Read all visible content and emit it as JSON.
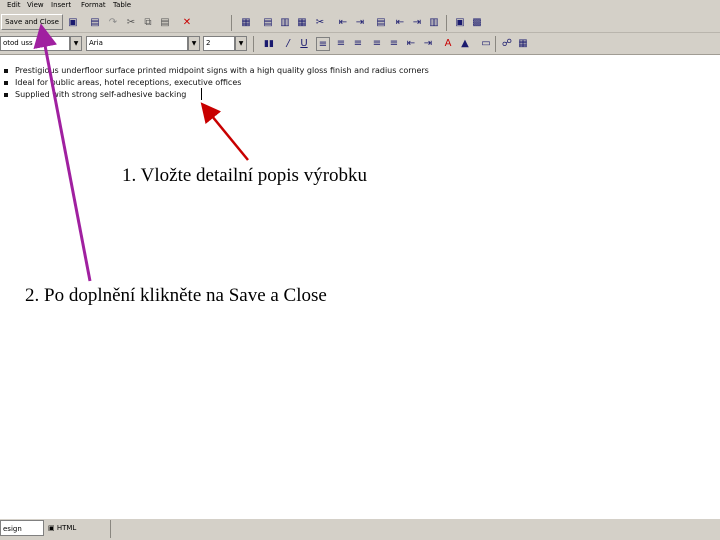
{
  "menu": {
    "items": [
      "Edit",
      "View",
      "Insert",
      "Format",
      "Table"
    ]
  },
  "toolbar": {
    "save_and_close_label": "Save and Close"
  },
  "format_toolbar": {
    "style_value": "otod uss",
    "font_value": "Aria",
    "size_value": "2"
  },
  "content": {
    "bullets": [
      "Prestigious underfloor surface printed midpoint signs with a high quality gloss finish and radius corners",
      "Ideal for public areas, hotel receptions, executive offices",
      "Supplied with strong self-adhesive backing"
    ]
  },
  "annotations": {
    "step1": "1. Vložte detailní popis výrobku",
    "step2": "2. Po doplnění klikněte na  Save a Close"
  },
  "statusbar": {
    "design_tab": "esign",
    "html_tab": "HTML"
  },
  "colors": {
    "chrome": "#d4d0c8",
    "arrow_red": "#c80000",
    "arrow_purple": "#a020a0"
  }
}
